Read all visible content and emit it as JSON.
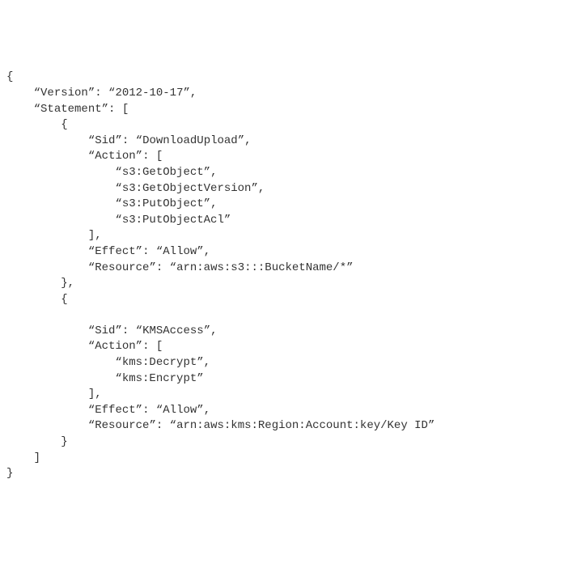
{
  "policy": {
    "version_key": "Version",
    "version_value": "2012-10-17",
    "statement_key": "Statement",
    "statements": [
      {
        "sid_key": "Sid",
        "sid_value": "DownloadUpload",
        "action_key": "Action",
        "actions": [
          "s3:GetObject",
          "s3:GetObjectVersion",
          "s3:PutObject",
          "s3:PutObjectAcl"
        ],
        "effect_key": "Effect",
        "effect_value": "Allow",
        "resource_key": "Resource",
        "resource_value": "arn:aws:s3:::BucketName/*"
      },
      {
        "sid_key": "Sid",
        "sid_value": "KMSAccess",
        "action_key": "Action",
        "actions": [
          "kms:Decrypt",
          "kms:Encrypt"
        ],
        "effect_key": "Effect",
        "effect_value": "Allow",
        "resource_key": "Resource",
        "resource_value": "arn:aws:kms:Region:Account:key/Key ID"
      }
    ]
  },
  "glyphs": {
    "open_brace": "{",
    "close_brace": "}",
    "open_bracket": "[",
    "close_bracket": "]",
    "comma": ",",
    "colon": ":",
    "lquote": "“",
    "rquote": "”"
  }
}
